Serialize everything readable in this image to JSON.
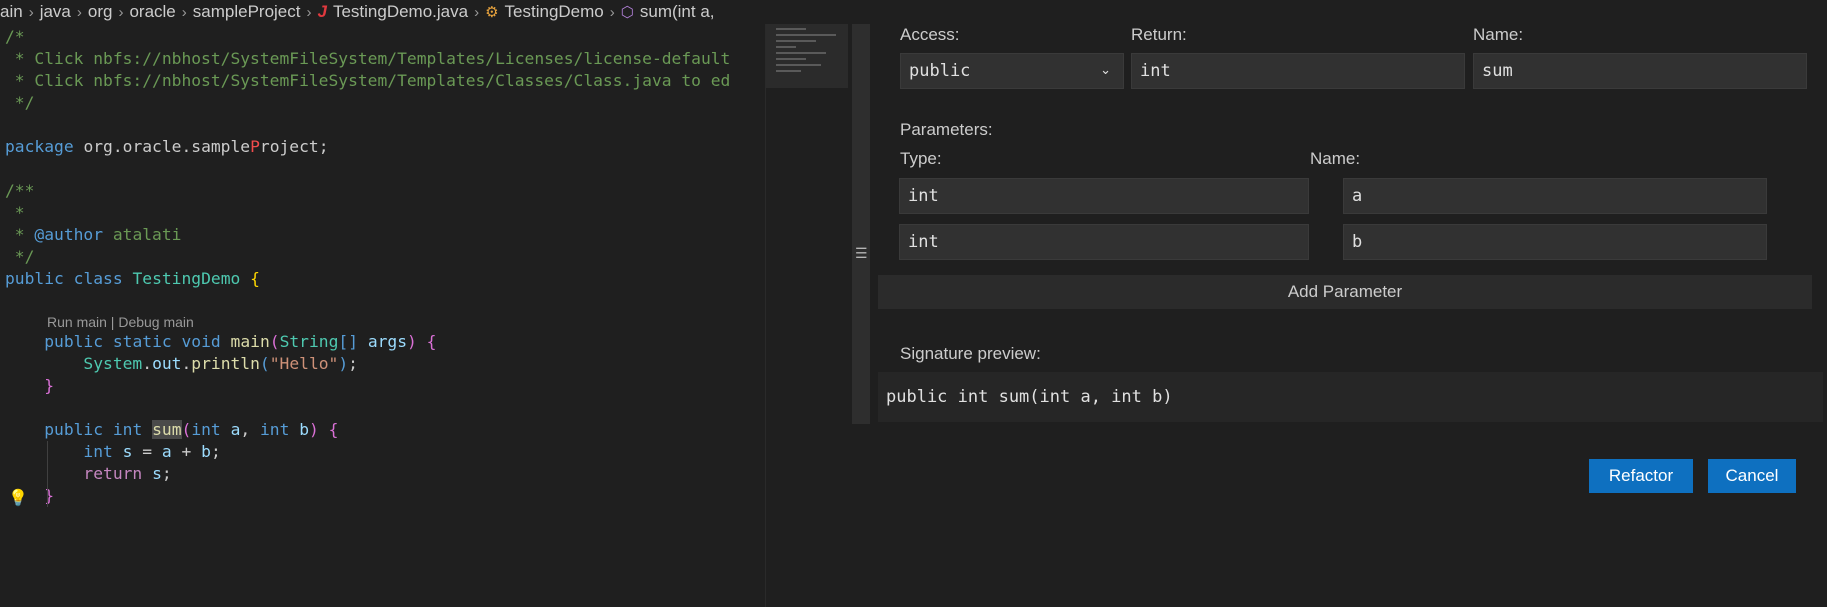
{
  "breadcrumb": {
    "items": [
      "ain",
      "java",
      "org",
      "oracle",
      "sampleProject"
    ],
    "file_icon": "J",
    "file": "TestingDemo.java",
    "class": "TestingDemo",
    "method": "sum(int a,"
  },
  "editor": {
    "lens_text": "Run main | Debug main"
  },
  "form": {
    "access_label": "Access:",
    "access_value": "public",
    "return_label": "Return:",
    "return_value": "int",
    "name_label": "Name:",
    "name_value": "sum",
    "parameters_label": "Parameters:",
    "type_col_label": "Type:",
    "name_col_label": "Name:",
    "params": [
      {
        "type": "int",
        "name": "a"
      },
      {
        "type": "int",
        "name": "b"
      }
    ],
    "add_parameter_label": "Add Parameter",
    "preview_label": "Signature preview:",
    "preview_value": "public int sum(int a, int b)",
    "refactor_label": "Refactor",
    "cancel_label": "Cancel"
  },
  "icons": {
    "chevron": "chevron-down-icon",
    "bulb": "lightbulb-icon",
    "class": "class-icon",
    "method": "method-cube-icon",
    "java": "java-file-icon"
  }
}
